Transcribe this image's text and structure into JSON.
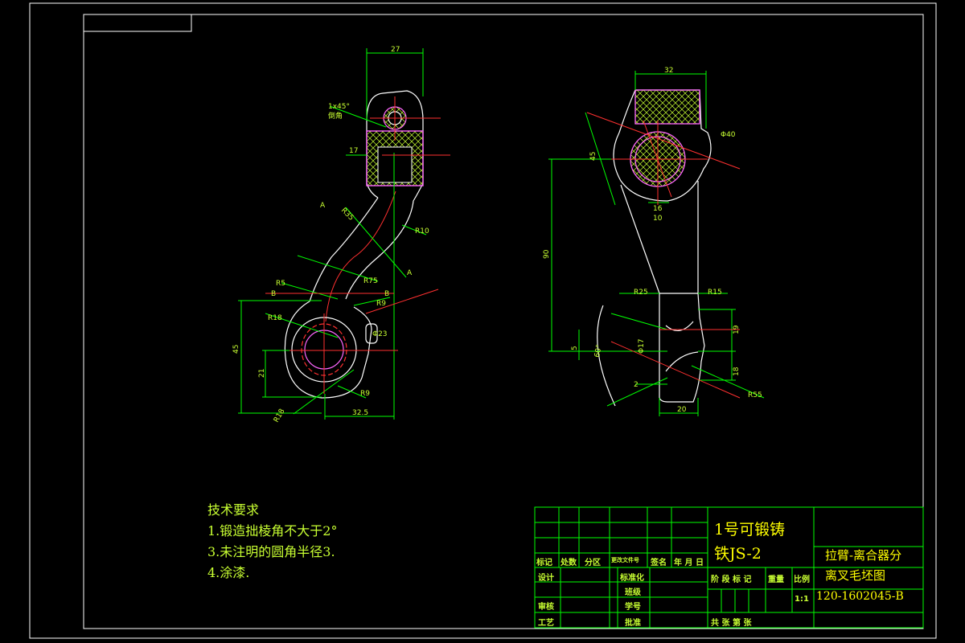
{
  "drawing": {
    "dims_front": {
      "d27": "27",
      "chamfer": "1x45°",
      "chamfer_note": "倒角",
      "d17": "17",
      "r35": "R35",
      "r10": "R10",
      "r75": "R75",
      "r5": "R5",
      "r9a": "R9",
      "r18a": "R18",
      "phi23": "Φ23",
      "d45": "45",
      "d21": "21",
      "r9b": "R9",
      "r18b": "R18",
      "d32_5": "32.5",
      "sec_a": "A",
      "sec_b": "B"
    },
    "dims_side": {
      "d32": "32",
      "phi40": "Φ40",
      "d45": "45",
      "d16": "16",
      "d90": "90",
      "r25": "R25",
      "r15": "R15",
      "d19": "19",
      "d18": "18",
      "d5": "5",
      "phi17": "Φ17",
      "d2": "2",
      "r55": "R55",
      "d20": "20",
      "d60": "60°",
      "d10": "10"
    }
  },
  "notes": {
    "title": "技术要求",
    "items": [
      "1.锻造拙棱角不大于2°",
      "3.未注明的圆角半径3.",
      "4.涂漆."
    ]
  },
  "title_block": {
    "material_line1": "1号可锻铸",
    "material_line2": "铁JS-2",
    "part_name_line1": "拉臂-离合器分",
    "part_name_line2": "离叉毛坯图",
    "drawing_number": "120-1602045-B",
    "headers": [
      "标记",
      "处数",
      "分区",
      "更改文件号",
      "签名",
      "年 月 日"
    ],
    "role_design": "设计",
    "role_standard": "标准化",
    "role_review": "审核",
    "role_craft": "工艺",
    "role_approve": "批准",
    "role_proofread": "班级",
    "role_student": "学号",
    "stage": "阶 段 标 记",
    "weight": "重量",
    "scale_label": "比例",
    "scale_value": "1:1",
    "sheets": "共    张   第    张"
  }
}
